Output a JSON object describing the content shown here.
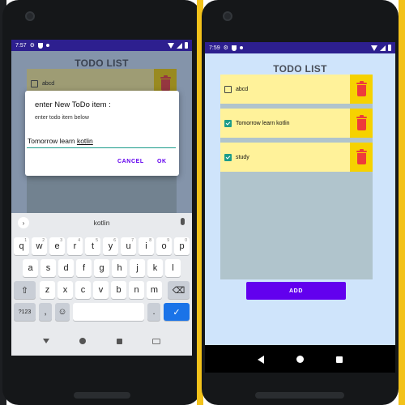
{
  "left_phone": {
    "status": {
      "time": "7:57"
    },
    "app_title": "TODO LIST",
    "bg_item": {
      "text": "abcd",
      "checked": false
    },
    "dialog": {
      "title": "enter New ToDo item :",
      "message": "enter todo item below",
      "input_prefix": "Tomorrow learn ",
      "input_underlined": "kotlin",
      "cancel_label": "CANCEL",
      "ok_label": "OK"
    },
    "keyboard": {
      "suggestion": "kotlin",
      "row1": [
        [
          "q",
          "1"
        ],
        [
          "w",
          "2"
        ],
        [
          "e",
          "3"
        ],
        [
          "r",
          "4"
        ],
        [
          "t",
          "5"
        ],
        [
          "y",
          "6"
        ],
        [
          "u",
          "7"
        ],
        [
          "i",
          "8"
        ],
        [
          "o",
          "9"
        ],
        [
          "p",
          "0"
        ]
      ],
      "row2": [
        "a",
        "s",
        "d",
        "f",
        "g",
        "h",
        "j",
        "k",
        "l"
      ],
      "row3": [
        "z",
        "x",
        "c",
        "v",
        "b",
        "n",
        "m"
      ],
      "numbers_label": "?123",
      "comma": ",",
      "period": "."
    }
  },
  "right_phone": {
    "status": {
      "time": "7:59"
    },
    "app_title": "TODO LIST",
    "items": [
      {
        "text": "abcd",
        "checked": false
      },
      {
        "text": "Tomorrow learn kotlin",
        "checked": true
      },
      {
        "text": "study",
        "checked": true
      }
    ],
    "add_label": "ADD"
  },
  "colors": {
    "status_bar": "#2d1f8f",
    "screen_bg": "#cfe4fb",
    "list_panel": "#b0c4cc",
    "item_bg": "#fff29a",
    "delete_bg": "#f6d200",
    "trash": "#ee3b3b",
    "accent": "#6200ee",
    "checkbox": "#1b9c8a"
  }
}
